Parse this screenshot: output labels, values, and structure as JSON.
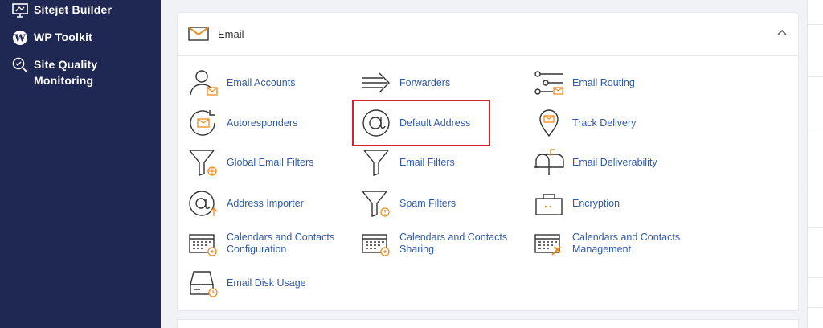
{
  "sidebar": {
    "items": [
      {
        "label": "Sitejet Builder",
        "icon": "monitor-icon"
      },
      {
        "label": "WP Toolkit",
        "icon": "wordpress-icon"
      },
      {
        "label": "Site Quality\nMonitoring",
        "icon": "magnifier-check-icon"
      }
    ]
  },
  "section": {
    "title": "Email",
    "icon": "envelope-icon",
    "collapse_icon": "chevron-up-icon"
  },
  "tools": [
    {
      "label": "Email Accounts",
      "icon": "user-mail-icon"
    },
    {
      "label": "Forwarders",
      "icon": "arrow-forward-icon"
    },
    {
      "label": "Email Routing",
      "icon": "routing-icon"
    },
    {
      "label": "Autoresponders",
      "icon": "autoresponder-icon"
    },
    {
      "label": "Default Address",
      "icon": "at-sign-icon"
    },
    {
      "label": "Track Delivery",
      "icon": "location-pin-icon"
    },
    {
      "label": "Global Email Filters",
      "icon": "funnel-globe-icon"
    },
    {
      "label": "Email Filters",
      "icon": "funnel-icon"
    },
    {
      "label": "Email Deliverability",
      "icon": "mailbox-icon"
    },
    {
      "label": "Address Importer",
      "icon": "at-import-icon"
    },
    {
      "label": "Spam Filters",
      "icon": "funnel-warning-icon"
    },
    {
      "label": "Encryption",
      "icon": "lock-box-icon"
    },
    {
      "label": "Calendars and Contacts\nConfiguration",
      "icon": "calendar-gear-icon"
    },
    {
      "label": "Calendars and Contacts\nSharing",
      "icon": "calendar-share-icon"
    },
    {
      "label": "Calendars and Contacts\nManagement",
      "icon": "calendar-manage-icon"
    },
    {
      "label": "Email Disk Usage",
      "icon": "disk-usage-icon"
    }
  ],
  "colors": {
    "sidebar_bg": "#1f2753",
    "accent_orange": "#f08c1e",
    "link_blue": "#2f5ba3",
    "highlight_red": "#d6222a"
  }
}
